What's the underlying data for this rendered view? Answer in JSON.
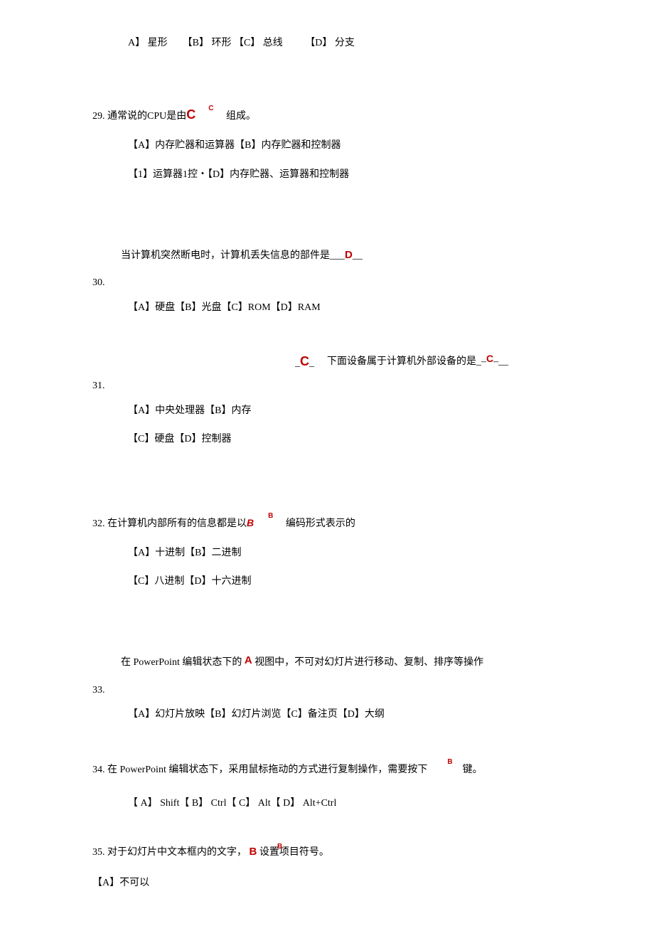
{
  "q28": {
    "optA": "A】 星形",
    "optB": "【B】 环形",
    "optC": "【C】 总线",
    "optD": "【D】 分支"
  },
  "q29": {
    "num": "29.",
    "pre": "通常说的CPU是由",
    "ans": "C",
    "sup": "C",
    "post": "组成。",
    "line1": "【A】内存贮器和运算器【B】内存贮器和控制器",
    "line2": "【1】运算器1控・【D】内存贮器、运算器和控制器"
  },
  "q30": {
    "num": "30.",
    "pre": "当计算机突然断电时，计算机丢失信息的部件是___",
    "ans": "D",
    "post": "__",
    "opts": "【A】硬盘【B】光盘【C】ROM【D】RAM"
  },
  "q31": {
    "num": "31.",
    "fillpre": "_",
    "fillans": "C",
    "fillpost": "_",
    "pre": "下面设备属于计算机外部设备的是_",
    "ans2pre": "–",
    "ans2": "C",
    "ans2post": "–__",
    "line1": "【A】中央处理器【B】内存",
    "line2": "【C】硬盘【D】控制器"
  },
  "q32": {
    "num": "32.",
    "pre": "在计算机内部所有的信息都是以",
    "ans": "B",
    "sup": "B",
    "post": "编码形式表示的",
    "line1": "【A】十进制【B】二进制",
    "line2": "【C】八进制【D】十六进制"
  },
  "q33": {
    "num": "33.",
    "pre": "在 PowerPoint 编辑状态下的 ",
    "ans": "A",
    "post": " 视图中，不可对幻灯片进行移动、复制、排序等操作",
    "opts": "【A】幻灯片放映【B】幻灯片浏览【C】备注页【D】大纲"
  },
  "q34": {
    "num": "34.",
    "pre": " 在 PowerPoint 编辑状态下，采用鼠标拖动的方式进行复制操作，需要按下",
    "sup": "B",
    "post": "键。",
    "opts": "【 A】 Shift【 B】 Ctrl【 C】 Alt【 D】 Alt+Ctrl"
  },
  "q35": {
    "num": "35.",
    "pre": " 对于幻灯片中文本框内的文字，",
    "ans": "B",
    "sup": "B",
    "post": "设置项目符号。",
    "optA": "【A】不可以"
  }
}
